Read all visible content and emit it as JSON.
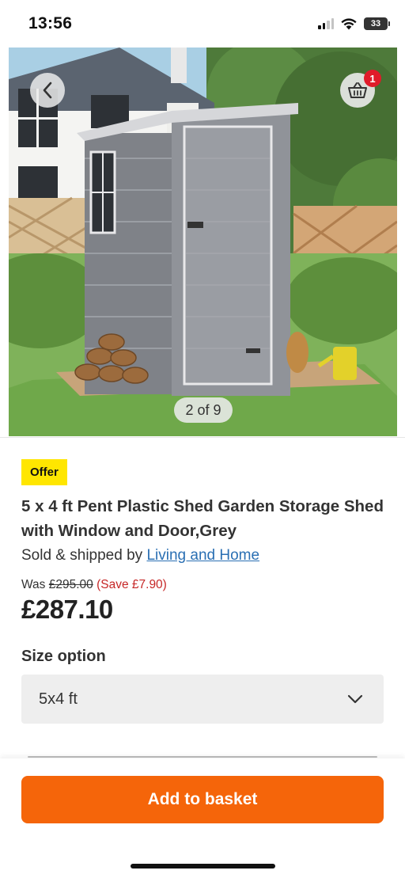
{
  "status_bar": {
    "time": "13:56",
    "battery": "33",
    "icons": [
      "signal-icon",
      "wifi-icon",
      "battery-icon"
    ]
  },
  "gallery": {
    "pager": "2 of 9",
    "basket_count": "1",
    "icons": [
      "back-chevron-icon",
      "basket-icon"
    ]
  },
  "product": {
    "badge": "Offer",
    "title": "5 x 4 ft Pent Plastic Shed Garden Storage Shed with Window and Door,Grey",
    "seller_prefix": "Sold & shipped by",
    "seller_name": "Living and Home",
    "was_label": "Was",
    "was_price": "£295.00",
    "save_text": "(Save £7.90)",
    "price": "£287.10"
  },
  "size": {
    "label": "Size option",
    "selected": "5x4 ft"
  },
  "actions": {
    "add_to_basket": "Add to basket"
  },
  "colors": {
    "primary_button": "#f5650a",
    "offer_badge": "#ffe600",
    "link": "#2a6fb3",
    "save_text": "#c62828",
    "basket_badge": "#e01b2a"
  }
}
